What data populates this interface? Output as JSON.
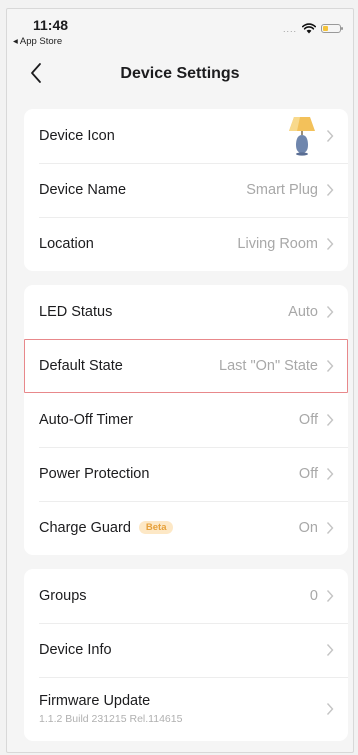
{
  "status_bar": {
    "time": "11:48",
    "back_app": "◂ App Store",
    "signal": "....",
    "battery_color": "#f4c33a"
  },
  "nav": {
    "title": "Device Settings"
  },
  "groups": [
    {
      "rows": [
        {
          "label": "Device Icon",
          "value": "",
          "icon": "lamp-icon"
        },
        {
          "label": "Device Name",
          "value": "Smart Plug"
        },
        {
          "label": "Location",
          "value": "Living Room"
        }
      ]
    },
    {
      "rows": [
        {
          "label": "LED Status",
          "value": "Auto"
        },
        {
          "label": "Default State",
          "value": "Last \"On\" State",
          "highlighted": true
        },
        {
          "label": "Auto-Off Timer",
          "value": "Off"
        },
        {
          "label": "Power Protection",
          "value": "Off"
        },
        {
          "label": "Charge Guard",
          "badge": "Beta",
          "value": "On"
        }
      ]
    },
    {
      "rows": [
        {
          "label": "Groups",
          "value": "0"
        },
        {
          "label": "Device Info",
          "value": ""
        },
        {
          "label": "Firmware Update",
          "subtitle": "1.1.2 Build 231215 Rel.114615",
          "value": ""
        }
      ]
    }
  ],
  "colors": {
    "highlight_border": "#e8888b",
    "badge_text": "#e6a03a",
    "badge_bg": "#fde8c6"
  }
}
